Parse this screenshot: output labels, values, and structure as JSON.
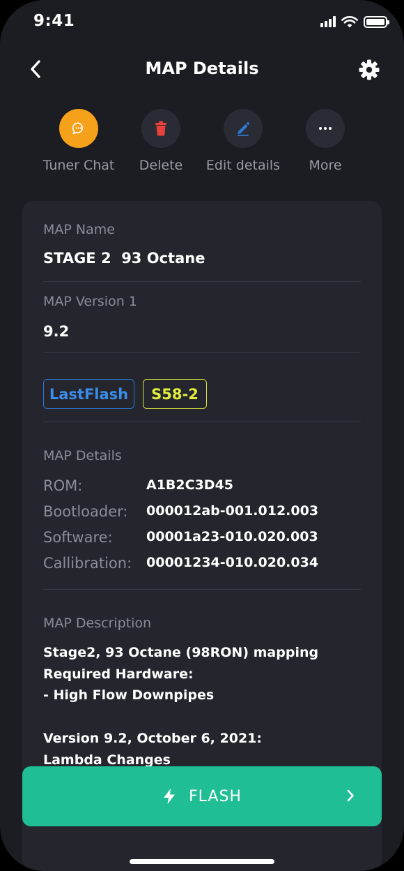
{
  "status_bar": {
    "time": "9:41"
  },
  "header": {
    "title": "MAP Details"
  },
  "actions": [
    {
      "label": "Tuner Chat",
      "icon": "chat-icon",
      "color": "#f5a11a"
    },
    {
      "label": "Delete",
      "icon": "trash-icon",
      "color": "#e8403a"
    },
    {
      "label": "Edit details",
      "icon": "pencil-icon",
      "color": "#2f7ad3"
    },
    {
      "label": "More",
      "icon": "more-icon",
      "color": "#ffffff"
    }
  ],
  "map": {
    "name_label": "MAP Name",
    "name_value": "STAGE 2  93 Octane",
    "version_label": "MAP Version 1",
    "version_value": "9.2",
    "tags": [
      {
        "label": "LastFlash",
        "color": "#3b8ce6"
      },
      {
        "label": "S58-2",
        "color": "#e2ee3d"
      }
    ],
    "details_label": "MAP Details",
    "details": [
      {
        "key": "ROM:",
        "value": "A1B2C3D45"
      },
      {
        "key": "Bootloader:",
        "value": "000012ab-001.012.003"
      },
      {
        "key": "Software:",
        "value": "00001a23-010.020.003"
      },
      {
        "key": "Callibration:",
        "value": "00001234-010.020.034"
      }
    ],
    "description_label": "MAP Description",
    "description_lines": [
      "Stage2, 93 Octane (98RON) mapping",
      "Required Hardware:",
      "- High Flow Downpipes",
      "Version 9.2, October 6, 2021:",
      "Lambda Changes"
    ]
  },
  "flash_button": {
    "label": "FLASH",
    "color": "#1fbe94"
  }
}
